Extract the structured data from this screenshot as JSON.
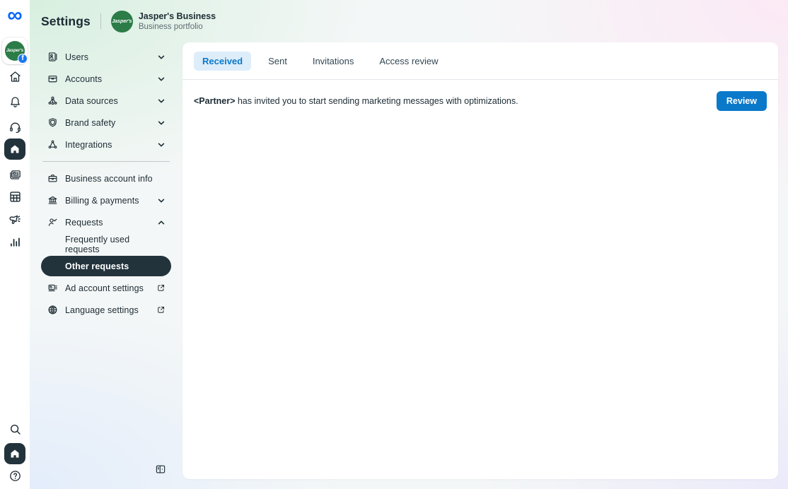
{
  "colors": {
    "accent_blue": "#0b79ca",
    "tab_pill_bg": "#ddedfa",
    "dark_pill": "#22333c",
    "avatar_green": "#2b7c47",
    "facebook_blue": "#1877f2",
    "meta_blue": "#0866ff",
    "text_primary": "#1c2b33",
    "gradient_corners": [
      "#d7efdf",
      "#fce9f5",
      "#ebeafa",
      "#e3edfb"
    ]
  },
  "header": {
    "title": "Settings",
    "business_name": "Jasper's Business",
    "business_type": "Business portfolio",
    "avatar_label": "Jasper's"
  },
  "rail": {
    "icons": [
      "meta-logo",
      "business-avatar-with-facebook-badge",
      "home",
      "notifications-bell",
      "support-headset",
      "business-home-selected",
      "pages-posts",
      "planner-table",
      "promote-megaphone",
      "insights-bars",
      "search",
      "home-shortcut",
      "help-question"
    ]
  },
  "sidebar": {
    "items": [
      {
        "label": "Users",
        "chevron": "down"
      },
      {
        "label": "Accounts",
        "chevron": "down"
      },
      {
        "label": "Data sources",
        "chevron": "down"
      },
      {
        "label": "Brand safety",
        "chevron": "down"
      },
      {
        "label": "Integrations",
        "chevron": "down"
      },
      {
        "label": "Business account info"
      },
      {
        "label": "Billing & payments",
        "chevron": "down"
      },
      {
        "label": "Requests",
        "chevron": "up"
      },
      {
        "label": "Frequently used requests",
        "sub": true
      },
      {
        "label": "Other requests",
        "sub": true,
        "selected": true
      },
      {
        "label": "Ad account settings",
        "external": true
      },
      {
        "label": "Language settings",
        "external": true
      }
    ]
  },
  "main": {
    "tabs": [
      {
        "label": "Received",
        "selected": true
      },
      {
        "label": "Sent",
        "selected": false
      },
      {
        "label": "Invitations",
        "selected": false
      },
      {
        "label": "Access review",
        "selected": false
      }
    ],
    "request": {
      "partner": "<Partner>",
      "message": " has invited you to start sending marketing messages with optimizations.",
      "action": "Review"
    }
  }
}
